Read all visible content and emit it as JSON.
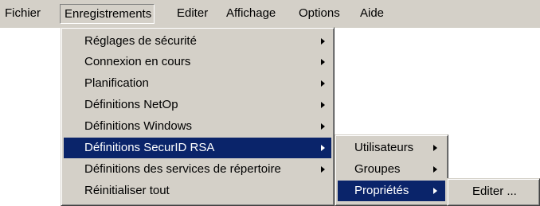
{
  "menubar": {
    "items": [
      {
        "label": "Fichier"
      },
      {
        "label": "Enregistrements"
      },
      {
        "label": "Editer"
      },
      {
        "label": "Affichage"
      },
      {
        "label": "Options"
      },
      {
        "label": "Aide"
      }
    ]
  },
  "enregistrements_menu": {
    "items": [
      {
        "label": "Réglages de sécurité",
        "submenu": true
      },
      {
        "label": "Connexion en cours",
        "submenu": true
      },
      {
        "label": "Planification",
        "submenu": true
      },
      {
        "label": "Définitions NetOp",
        "submenu": true
      },
      {
        "label": "Définitions Windows",
        "submenu": true
      },
      {
        "label": "Définitions SecurID RSA",
        "submenu": true,
        "highlighted": true
      },
      {
        "label": "Définitions des services de répertoire",
        "submenu": true
      },
      {
        "label": "Réinitialiser tout",
        "submenu": false
      }
    ]
  },
  "securid_submenu": {
    "items": [
      {
        "label": "Utilisateurs",
        "submenu": true
      },
      {
        "label": "Groupes",
        "submenu": true
      },
      {
        "label": "Propriétés",
        "submenu": true,
        "highlighted": true
      }
    ]
  },
  "proprietes_submenu": {
    "items": [
      {
        "label": "Editer ..."
      }
    ]
  },
  "colors": {
    "menu_face": "#d4d0c8",
    "highlight": "#0a246a",
    "highlight_text": "#ffffff",
    "text": "#000000"
  }
}
